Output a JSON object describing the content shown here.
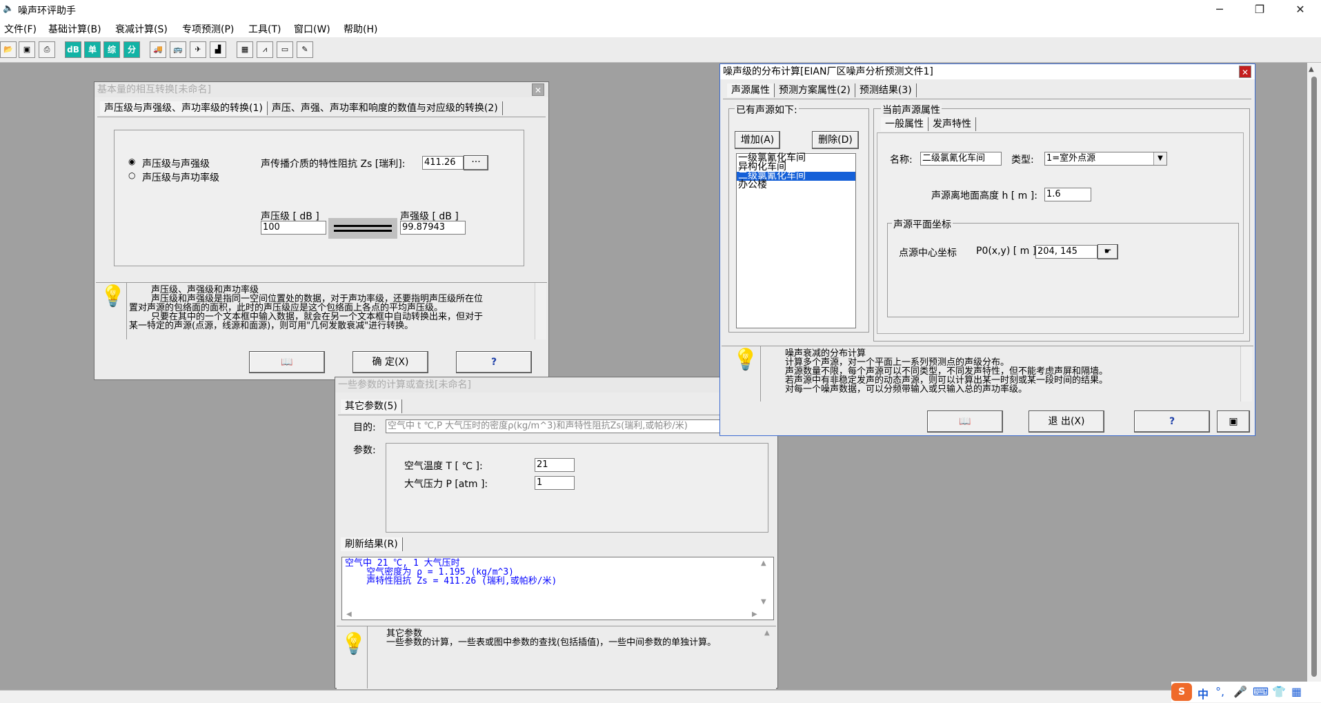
{
  "app": {
    "title": "噪声环评助手",
    "menu": [
      "文件(F)",
      "基础计算(B)",
      "衰减计算(S)",
      "专项预测(P)",
      "工具(T)",
      "窗口(W)",
      "帮助(H)"
    ],
    "toolbar_icons": [
      "open-folder-icon",
      "save-icon",
      "print-icon",
      "db-icon",
      "single-icon",
      "composite-icon",
      "divide-icon",
      "truck-icon",
      "bus-icon",
      "plane-icon",
      "chart-icon",
      "grid-icon",
      "line-chart-icon",
      "monitor-icon",
      "notepad-icon"
    ],
    "toolbar_labels": {
      "db": "dB",
      "single": "单",
      "composite": "综",
      "divide": "分"
    }
  },
  "conv_window": {
    "title": "基本量的相互转换[未命名]",
    "tabs": [
      "声压级与声强级、声功率级的转换(1)",
      "声压、声强、声功率和响度的数值与对应级的转换(2)"
    ],
    "radio1": "声压级与声强级",
    "radio2": "声压级与声功率级",
    "impedance_label": "声传播介质的特性阻抗 Zs [瑞利]:",
    "impedance_value": "411.26",
    "more_button": "···",
    "spl_label": "声压级 [ dB ]",
    "spl_value": "100",
    "sil_label": "声强级 [ dB ]",
    "sil_value": "99.87943",
    "help_lines": [
      "声压级、声强级和声功率级",
      "声压级和声强级是指同一空间位置处的数据，对于声功率级，还要指明声压级所在位",
      "置对声源的包络面的面积，此时的声压级应是这个包络面上各点的平均声压级。",
      "只要在其中的一个文本框中输入数据，就会在另一个文本框中自动转换出来，但对于",
      "某一特定的声源(点源，线源和面源)，则可用\"几何发散衰减\"进行转换。"
    ],
    "ok_button": "确 定(X)"
  },
  "param_window": {
    "title": "一些参数的计算或查找[未命名]",
    "tab": "其它参数(5)",
    "purpose_label": "目的:",
    "purpose_value": "空气中 t ℃,P 大气压时的密度ρ(kg/m^3)和声特性阻抗Zs(瑞利,或帕秒/米)",
    "params_label": "参数:",
    "temp_label": "空气温度 T [ ℃ ]:",
    "temp_value": "21",
    "pressure_label": "大气压力 P [atm ]:",
    "pressure_value": "1",
    "refresh_button": "刷新结果(R)",
    "result_lines": [
      "空气中 21 ℃, 1 大气压时",
      "    空气密度为 ρ = 1.195 (kg/m^3)",
      "    声特性阻抗 Zs = 411.26 (瑞利,或帕秒/米)"
    ],
    "help_lines": [
      "其它参数",
      "一些参数的计算，一些表或图中参数的查找(包括插值)，一些中间参数的单独计算。"
    ]
  },
  "dist_window": {
    "title": "噪声级的分布计算[EIAN厂区噪声分析预测文件1]",
    "tabs": [
      "声源属性",
      "预测方案属性(2)",
      "预测结果(3)"
    ],
    "sources_group": "已有声源如下:",
    "add_button": "增加(A)",
    "delete_button": "删除(D)",
    "sources": [
      "一级氯氰化车间",
      "异构化车间",
      "二级氯氰化车间",
      "办公楼"
    ],
    "selected_index": 2,
    "current_group": "当前声源属性",
    "subtabs": [
      "一般属性",
      "发声特性"
    ],
    "name_label": "名称:",
    "name_value": "二级氯氰化车间",
    "type_label": "类型:",
    "type_value": "1=室外点源",
    "height_label": "声源离地面高度  h [ m ]:",
    "height_value": "1.6",
    "coords_group": "声源平面坐标",
    "center_label": "点源中心坐标",
    "p0_label": "P0(x,y) [ m ]:",
    "p0_value": "204, 145",
    "help_lines": [
      "噪声衰减的分布计算",
      "计算多个声源，对一个平面上一系列预测点的声级分布。",
      "声源数量不限，每个声源可以不同类型，不同发声特性，但不能考虑声屏和隔墙。",
      "若声源中有非稳定发声的动态声源，则可以计算出某一时刻或某一段时间的结果。",
      "对每一个噪声数据，可以分频带输入或只输入总的声功率级。"
    ],
    "exit_button": "退 出(X)"
  },
  "taskbar": {
    "ime": "中"
  }
}
